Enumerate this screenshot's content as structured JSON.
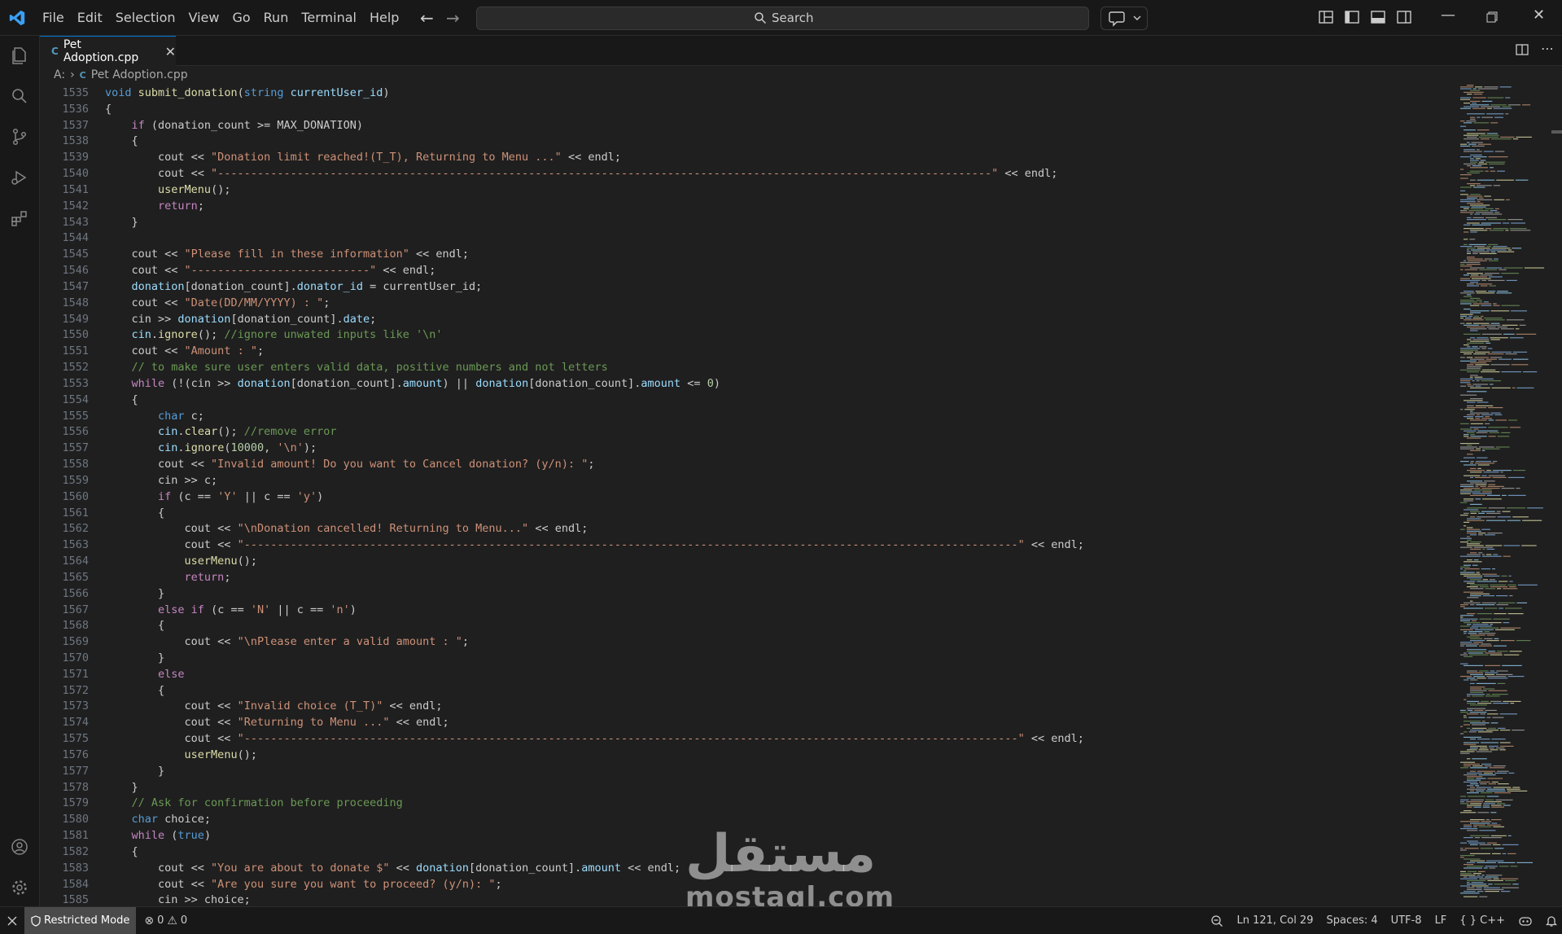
{
  "menu": [
    "File",
    "Edit",
    "Selection",
    "View",
    "Go",
    "Run",
    "Terminal",
    "Help"
  ],
  "search": {
    "placeholder": "Search"
  },
  "tab": {
    "label": "Pet Adoption.cpp",
    "icon": "C"
  },
  "breadcrumb": {
    "drive": "A:",
    "file": "Pet Adoption.cpp"
  },
  "colors": {
    "keyword": "#569cd6",
    "control": "#c586c0",
    "string": "#ce9178",
    "comment": "#6a9955",
    "function": "#dcdcaa",
    "variable": "#9cdcfe",
    "type": "#4ec9b0",
    "number": "#b5cea8",
    "plain": "#cccccc"
  },
  "code": [
    {
      "n": "1535",
      "t": [
        [
          "k",
          "void"
        ],
        [
          "p",
          " "
        ],
        [
          "f",
          "submit_donation"
        ],
        [
          "p",
          "("
        ],
        [
          "k",
          "string"
        ],
        [
          "p",
          " "
        ],
        [
          "v",
          "currentUser_id"
        ],
        [
          "p",
          ")"
        ]
      ]
    },
    {
      "n": "1536",
      "t": [
        [
          "p",
          "{"
        ]
      ]
    },
    {
      "n": "1537",
      "t": [
        [
          "p",
          "    "
        ],
        [
          "c",
          "if"
        ],
        [
          "p",
          " (donation_count >= MAX_DONATION)"
        ]
      ]
    },
    {
      "n": "1538",
      "t": [
        [
          "p",
          "    {"
        ]
      ]
    },
    {
      "n": "1539",
      "t": [
        [
          "p",
          "        cout << "
        ],
        [
          "s",
          "\"Donation limit reached!(T_T), Returning to Menu ...\""
        ],
        [
          "p",
          " << endl;"
        ]
      ]
    },
    {
      "n": "1540",
      "t": [
        [
          "p",
          "        cout << "
        ],
        [
          "s",
          "\"---------------------------------------------------------------------------------------------------------------------\""
        ],
        [
          "p",
          " << endl;"
        ]
      ]
    },
    {
      "n": "1541",
      "t": [
        [
          "p",
          "        "
        ],
        [
          "f",
          "userMenu"
        ],
        [
          "p",
          "();"
        ]
      ]
    },
    {
      "n": "1542",
      "t": [
        [
          "p",
          "        "
        ],
        [
          "c",
          "return"
        ],
        [
          "p",
          ";"
        ]
      ]
    },
    {
      "n": "1543",
      "t": [
        [
          "p",
          "    }"
        ]
      ]
    },
    {
      "n": "1544",
      "t": [
        [
          "p",
          ""
        ]
      ]
    },
    {
      "n": "1545",
      "t": [
        [
          "p",
          "    cout << "
        ],
        [
          "s",
          "\"Please fill in these information\""
        ],
        [
          "p",
          " << endl;"
        ]
      ]
    },
    {
      "n": "1546",
      "t": [
        [
          "p",
          "    cout << "
        ],
        [
          "s",
          "\"---------------------------\""
        ],
        [
          "p",
          " << endl;"
        ]
      ]
    },
    {
      "n": "1547",
      "t": [
        [
          "p",
          "    "
        ],
        [
          "v",
          "donation"
        ],
        [
          "p",
          "[donation_count]."
        ],
        [
          "v",
          "donator_id"
        ],
        [
          "p",
          " = currentUser_id;"
        ]
      ]
    },
    {
      "n": "1548",
      "t": [
        [
          "p",
          "    cout << "
        ],
        [
          "s",
          "\"Date(DD/MM/YYYY) : \""
        ],
        [
          "p",
          ";"
        ]
      ]
    },
    {
      "n": "1549",
      "t": [
        [
          "p",
          "    cin >> "
        ],
        [
          "v",
          "donation"
        ],
        [
          "p",
          "[donation_count]."
        ],
        [
          "v",
          "date"
        ],
        [
          "p",
          ";"
        ]
      ]
    },
    {
      "n": "1550",
      "t": [
        [
          "p",
          "    "
        ],
        [
          "v",
          "cin"
        ],
        [
          "p",
          "."
        ],
        [
          "f",
          "ignore"
        ],
        [
          "p",
          "(); "
        ],
        [
          "m",
          "//ignore unwated inputs like '\\n'"
        ]
      ]
    },
    {
      "n": "1551",
      "t": [
        [
          "p",
          "    cout << "
        ],
        [
          "s",
          "\"Amount : \""
        ],
        [
          "p",
          ";"
        ]
      ]
    },
    {
      "n": "1552",
      "t": [
        [
          "p",
          "    "
        ],
        [
          "m",
          "// to make sure user enters valid data, positive numbers and not letters"
        ]
      ]
    },
    {
      "n": "1553",
      "t": [
        [
          "p",
          "    "
        ],
        [
          "c",
          "while"
        ],
        [
          "p",
          " (!(cin >> "
        ],
        [
          "v",
          "donation"
        ],
        [
          "p",
          "[donation_count]."
        ],
        [
          "v",
          "amount"
        ],
        [
          "p",
          ") || "
        ],
        [
          "v",
          "donation"
        ],
        [
          "p",
          "[donation_count]."
        ],
        [
          "v",
          "amount"
        ],
        [
          "p",
          " <= "
        ],
        [
          "u",
          "0"
        ],
        [
          "p",
          ")"
        ]
      ]
    },
    {
      "n": "1554",
      "t": [
        [
          "p",
          "    {"
        ]
      ]
    },
    {
      "n": "1555",
      "t": [
        [
          "p",
          "        "
        ],
        [
          "k",
          "char"
        ],
        [
          "p",
          " c;"
        ]
      ]
    },
    {
      "n": "1556",
      "t": [
        [
          "p",
          "        "
        ],
        [
          "v",
          "cin"
        ],
        [
          "p",
          "."
        ],
        [
          "f",
          "clear"
        ],
        [
          "p",
          "(); "
        ],
        [
          "m",
          "//remove error"
        ]
      ]
    },
    {
      "n": "1557",
      "t": [
        [
          "p",
          "        "
        ],
        [
          "v",
          "cin"
        ],
        [
          "p",
          "."
        ],
        [
          "f",
          "ignore"
        ],
        [
          "p",
          "("
        ],
        [
          "u",
          "10000"
        ],
        [
          "p",
          ", "
        ],
        [
          "s",
          "'\\n'"
        ],
        [
          "p",
          ");"
        ]
      ]
    },
    {
      "n": "1558",
      "t": [
        [
          "p",
          "        cout << "
        ],
        [
          "s",
          "\"Invalid amount! Do you want to Cancel donation? (y/n): \""
        ],
        [
          "p",
          ";"
        ]
      ]
    },
    {
      "n": "1559",
      "t": [
        [
          "p",
          "        cin >> c;"
        ]
      ]
    },
    {
      "n": "1560",
      "t": [
        [
          "p",
          "        "
        ],
        [
          "c",
          "if"
        ],
        [
          "p",
          " (c == "
        ],
        [
          "s",
          "'Y'"
        ],
        [
          "p",
          " || c == "
        ],
        [
          "s",
          "'y'"
        ],
        [
          "p",
          ")"
        ]
      ]
    },
    {
      "n": "1561",
      "t": [
        [
          "p",
          "        {"
        ]
      ]
    },
    {
      "n": "1562",
      "t": [
        [
          "p",
          "            cout << "
        ],
        [
          "s",
          "\"\\nDonation cancelled! Returning to Menu...\""
        ],
        [
          "p",
          " << endl;"
        ]
      ]
    },
    {
      "n": "1563",
      "t": [
        [
          "p",
          "            cout << "
        ],
        [
          "s",
          "\"---------------------------------------------------------------------------------------------------------------------\""
        ],
        [
          "p",
          " << endl;"
        ]
      ]
    },
    {
      "n": "1564",
      "t": [
        [
          "p",
          "            "
        ],
        [
          "f",
          "userMenu"
        ],
        [
          "p",
          "();"
        ]
      ]
    },
    {
      "n": "1565",
      "t": [
        [
          "p",
          "            "
        ],
        [
          "c",
          "return"
        ],
        [
          "p",
          ";"
        ]
      ]
    },
    {
      "n": "1566",
      "t": [
        [
          "p",
          "        }"
        ]
      ]
    },
    {
      "n": "1567",
      "t": [
        [
          "p",
          "        "
        ],
        [
          "c",
          "else if"
        ],
        [
          "p",
          " (c == "
        ],
        [
          "s",
          "'N'"
        ],
        [
          "p",
          " || c == "
        ],
        [
          "s",
          "'n'"
        ],
        [
          "p",
          ")"
        ]
      ]
    },
    {
      "n": "1568",
      "t": [
        [
          "p",
          "        {"
        ]
      ]
    },
    {
      "n": "1569",
      "t": [
        [
          "p",
          "            cout << "
        ],
        [
          "s",
          "\"\\nPlease enter a valid amount : \""
        ],
        [
          "p",
          ";"
        ]
      ]
    },
    {
      "n": "1570",
      "t": [
        [
          "p",
          "        }"
        ]
      ]
    },
    {
      "n": "1571",
      "t": [
        [
          "p",
          "        "
        ],
        [
          "c",
          "else"
        ]
      ]
    },
    {
      "n": "1572",
      "t": [
        [
          "p",
          "        {"
        ]
      ]
    },
    {
      "n": "1573",
      "t": [
        [
          "p",
          "            cout << "
        ],
        [
          "s",
          "\"Invalid choice (T_T)\""
        ],
        [
          "p",
          " << endl;"
        ]
      ]
    },
    {
      "n": "1574",
      "t": [
        [
          "p",
          "            cout << "
        ],
        [
          "s",
          "\"Returning to Menu ...\""
        ],
        [
          "p",
          " << endl;"
        ]
      ]
    },
    {
      "n": "1575",
      "t": [
        [
          "p",
          "            cout << "
        ],
        [
          "s",
          "\"---------------------------------------------------------------------------------------------------------------------\""
        ],
        [
          "p",
          " << endl;"
        ]
      ]
    },
    {
      "n": "1576",
      "t": [
        [
          "p",
          "            "
        ],
        [
          "f",
          "userMenu"
        ],
        [
          "p",
          "();"
        ]
      ]
    },
    {
      "n": "1577",
      "t": [
        [
          "p",
          "        }"
        ]
      ]
    },
    {
      "n": "1578",
      "t": [
        [
          "p",
          "    }"
        ]
      ]
    },
    {
      "n": "1579",
      "t": [
        [
          "p",
          "    "
        ],
        [
          "m",
          "// Ask for confirmation before proceeding"
        ]
      ]
    },
    {
      "n": "1580",
      "t": [
        [
          "p",
          "    "
        ],
        [
          "k",
          "char"
        ],
        [
          "p",
          " choice;"
        ]
      ]
    },
    {
      "n": "1581",
      "t": [
        [
          "p",
          "    "
        ],
        [
          "c",
          "while"
        ],
        [
          "p",
          " ("
        ],
        [
          "k",
          "true"
        ],
        [
          "p",
          ")"
        ]
      ]
    },
    {
      "n": "1582",
      "t": [
        [
          "p",
          "    {"
        ]
      ]
    },
    {
      "n": "1583",
      "t": [
        [
          "p",
          "        cout << "
        ],
        [
          "s",
          "\"You are about to donate $\""
        ],
        [
          "p",
          " << "
        ],
        [
          "v",
          "donation"
        ],
        [
          "p",
          "[donation_count]."
        ],
        [
          "v",
          "amount"
        ],
        [
          "p",
          " << endl;"
        ]
      ]
    },
    {
      "n": "1584",
      "t": [
        [
          "p",
          "        cout << "
        ],
        [
          "s",
          "\"Are you sure you want to proceed? (y/n): \""
        ],
        [
          "p",
          ";"
        ]
      ]
    },
    {
      "n": "1585",
      "t": [
        [
          "p",
          "        cin >> choice;"
        ]
      ]
    }
  ],
  "status": {
    "restricted": "Restricted Mode",
    "errors": "0",
    "warnings": "0",
    "position": "Ln 121, Col 29",
    "spaces": "Spaces: 4",
    "encoding": "UTF-8",
    "eol": "LF",
    "language": "C++"
  },
  "watermark": {
    "arabic": "مستقل",
    "latin": "mostaql.com"
  }
}
